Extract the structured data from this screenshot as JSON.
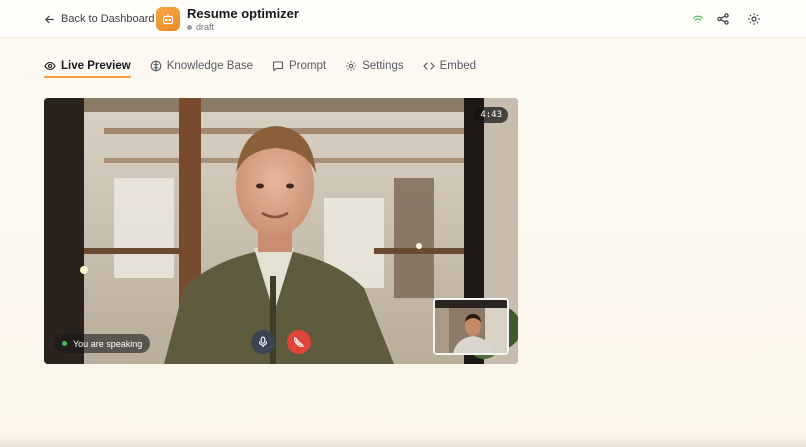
{
  "header": {
    "back_label": "Back to Dashboard",
    "app_title": "Resume optimizer",
    "app_status": "draft",
    "icons": [
      "wifi-icon",
      "share-icon",
      "gear-icon"
    ]
  },
  "tabs": [
    {
      "label": "Live Preview",
      "icon": "eye-icon",
      "active": true
    },
    {
      "label": "Knowledge Base",
      "icon": "brain-icon",
      "active": false
    },
    {
      "label": "Prompt",
      "icon": "message-icon",
      "active": false
    },
    {
      "label": "Settings",
      "icon": "gear-icon",
      "active": false
    },
    {
      "label": "Embed",
      "icon": "code-icon",
      "active": false
    }
  ],
  "video": {
    "timer": "4:43",
    "speaking_label": "You are speaking"
  },
  "colors": {
    "accent": "#ee9a3a",
    "hangup": "#e0453a",
    "mic": "#3c4452",
    "speaking_dot": "#3fbf5a",
    "wifi": "#3fbf5a"
  }
}
